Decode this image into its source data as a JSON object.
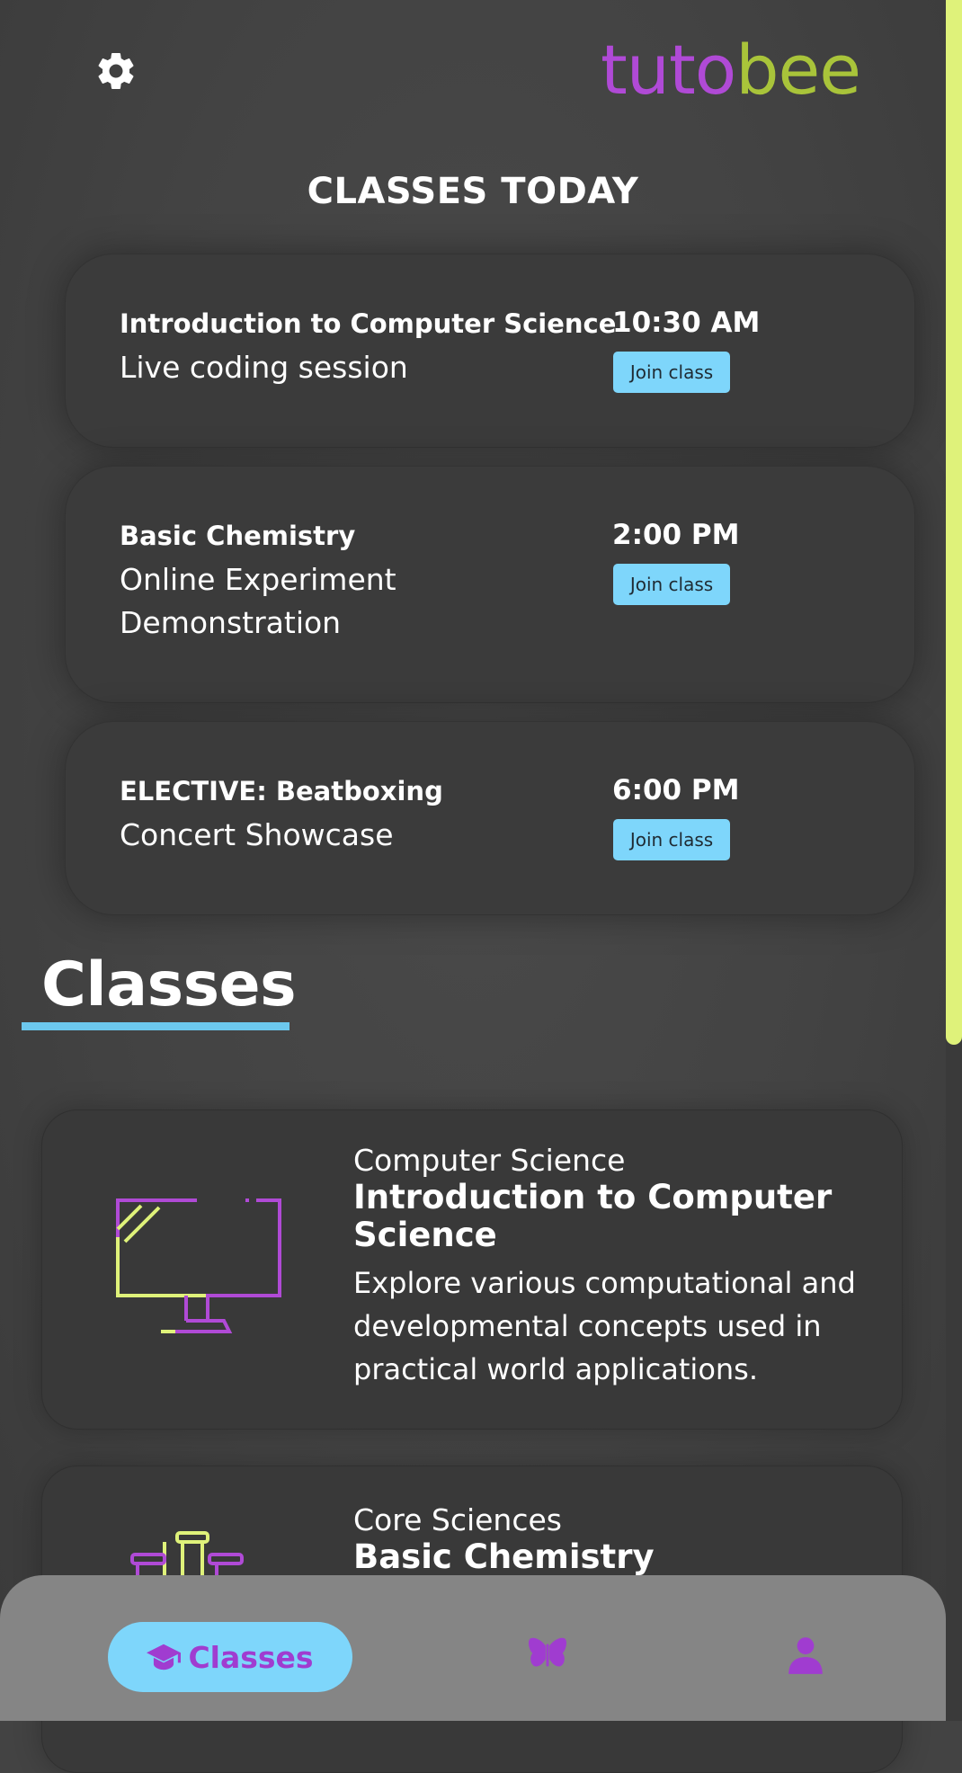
{
  "app": {
    "logo_part1": "tuto",
    "logo_part2": "bee",
    "colors": {
      "logo_purple": "#b04ad6",
      "logo_green": "#a9c43a",
      "accent_blue": "#7ed6fb",
      "scrollbar": "#dff27a"
    }
  },
  "header": {
    "settings_icon": "gear-icon"
  },
  "today": {
    "title": "CLASSES TODAY",
    "classes": [
      {
        "course": "Introduction to Computer Science",
        "description": "Live coding session",
        "time": "10:30 AM",
        "button": "Join class"
      },
      {
        "course": "Basic Chemistry",
        "description": "Online Experiment Demonstration",
        "time": "2:00 PM",
        "button": "Join class"
      },
      {
        "course": "ELECTIVE: Beatboxing",
        "description": "Concert Showcase",
        "time": "6:00 PM",
        "button": "Join class"
      }
    ]
  },
  "classes_section": {
    "title": "Classes",
    "items": [
      {
        "category": "Computer Science",
        "title": "Introduction to Computer Science",
        "description": "Explore various computational and developmental concepts used in practical world applications.",
        "icon": "computer-monitor-icon"
      },
      {
        "category": "Core Sciences",
        "title": "Basic Chemistry",
        "icon": "lab-flasks-icon"
      }
    ]
  },
  "bottom_nav": {
    "active_label": "Classes",
    "items": [
      {
        "label": "Classes",
        "icon": "graduation-cap-icon"
      },
      {
        "icon": "butterfly-icon"
      },
      {
        "icon": "user-icon"
      }
    ]
  }
}
